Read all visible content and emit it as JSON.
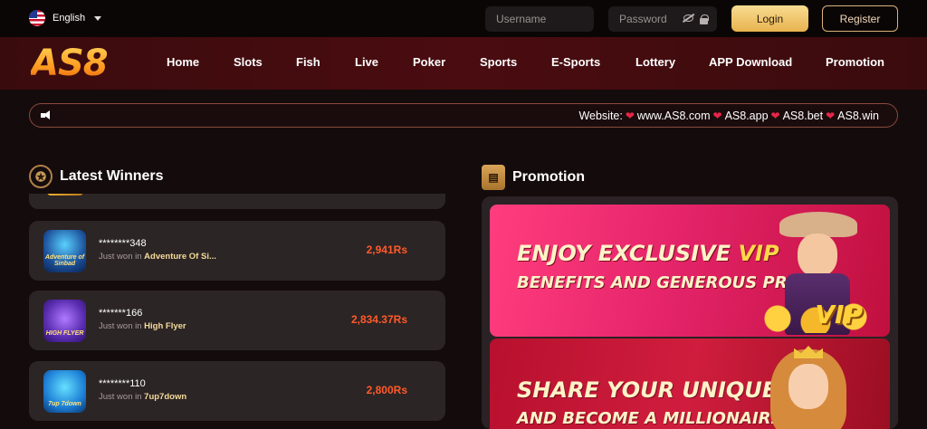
{
  "topbar": {
    "language": "English",
    "username_placeholder": "Username",
    "password_placeholder": "Password",
    "login_label": "Login",
    "register_label": "Register"
  },
  "brand": {
    "logo_text": "AS8"
  },
  "nav": {
    "items": [
      "Home",
      "Slots",
      "Fish",
      "Live",
      "Poker",
      "Sports",
      "E-Sports",
      "Lottery",
      "APP Download",
      "Promotion"
    ]
  },
  "marquee": {
    "prefix": "Website:",
    "sites": [
      "www.AS8.com",
      "AS8.app",
      "AS8.bet",
      "AS8.win"
    ]
  },
  "winners": {
    "title": "Latest Winners",
    "won_prefix": "Just won in",
    "items": [
      {
        "user": "********348",
        "game": "Adventure Of Si...",
        "amount": "2,941Rs",
        "thumb_text": "Adventure of Sinbad"
      },
      {
        "user": "*******166",
        "game": "High Flyer",
        "amount": "2,834.37Rs",
        "thumb_text": "HIGH FLYER"
      },
      {
        "user": "********110",
        "game": "7up7down",
        "amount": "2,800Rs",
        "thumb_text": "7up 7down"
      }
    ]
  },
  "promotion": {
    "title": "Promotion",
    "banners": [
      {
        "line1_a": "ENJOY EXCLUSIVE ",
        "line1_b": "VIP",
        "line2": "BENEFITS AND GENEROUS PRIZES!",
        "badge": "VIP"
      },
      {
        "line1": "SHARE YOUR UNIQUE LINK",
        "line2": "AND BECOME A MILLIONAIRE!"
      }
    ]
  },
  "colors": {
    "accent_gold": "#e8b34f",
    "amount_red": "#ff5a2a",
    "nav_bg": "#4a0c10"
  }
}
